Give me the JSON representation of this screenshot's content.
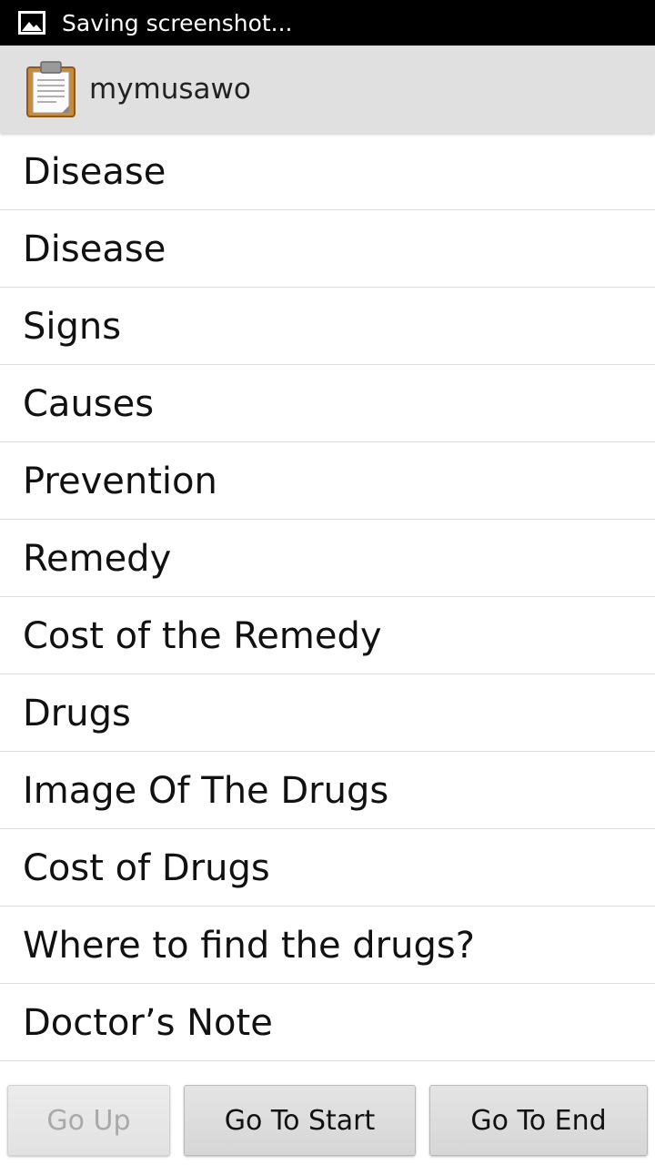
{
  "status_bar": {
    "icon": "image-icon",
    "text": "Saving screenshot..."
  },
  "action_bar": {
    "icon": "clipboard-icon",
    "title": "mymusawo"
  },
  "menu": {
    "items": [
      {
        "label": "Disease"
      },
      {
        "label": "Disease"
      },
      {
        "label": "Signs"
      },
      {
        "label": "Causes"
      },
      {
        "label": "Prevention"
      },
      {
        "label": "Remedy"
      },
      {
        "label": "Cost of the Remedy"
      },
      {
        "label": "Drugs"
      },
      {
        "label": "Image Of The Drugs"
      },
      {
        "label": "Cost of Drugs"
      },
      {
        "label": "Where to find the drugs?"
      },
      {
        "label": "Doctor’s Note"
      }
    ]
  },
  "buttons": {
    "up": {
      "label": "Go Up",
      "enabled": false
    },
    "start": {
      "label": "Go To Start",
      "enabled": true
    },
    "end": {
      "label": "Go To End",
      "enabled": true
    }
  },
  "colors": {
    "status_bar": "#000000",
    "action_bar": "#e0e0e0",
    "divider": "#dcdcdc",
    "disabled_text": "#a9a9a9"
  }
}
